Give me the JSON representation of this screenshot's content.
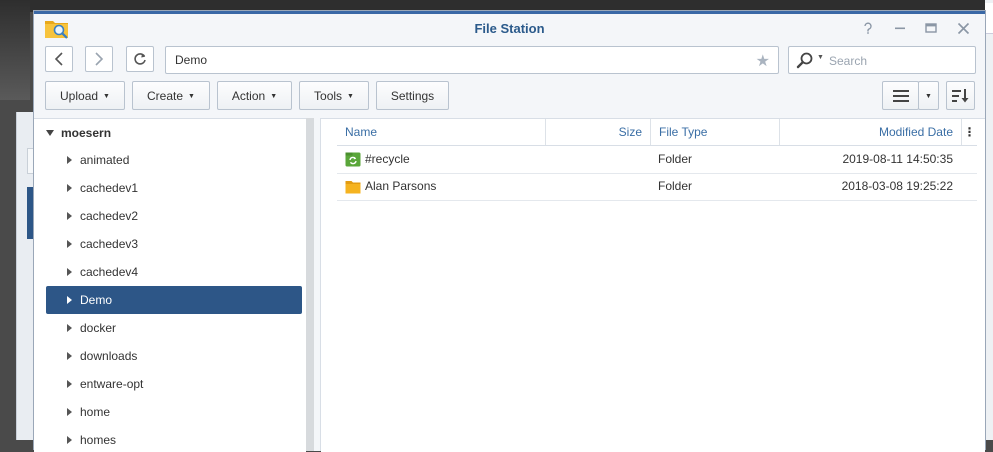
{
  "window": {
    "title": "File Station"
  },
  "nav": {
    "path": "Demo",
    "search_placeholder": "Search"
  },
  "toolbar": {
    "upload": "Upload",
    "create": "Create",
    "action": "Action",
    "tools": "Tools",
    "settings": "Settings"
  },
  "tree": {
    "root": "moesern",
    "items": [
      {
        "label": "animated"
      },
      {
        "label": "cachedev1"
      },
      {
        "label": "cachedev2"
      },
      {
        "label": "cachedev3"
      },
      {
        "label": "cachedev4"
      },
      {
        "label": "Demo",
        "selected": true
      },
      {
        "label": "docker"
      },
      {
        "label": "downloads"
      },
      {
        "label": "entware-opt"
      },
      {
        "label": "home"
      },
      {
        "label": "homes"
      }
    ]
  },
  "filelist": {
    "columns": {
      "name": "Name",
      "size": "Size",
      "type": "File Type",
      "modified": "Modified Date"
    },
    "rows": [
      {
        "name": "#recycle",
        "size": "",
        "type": "Folder",
        "modified": "2019-08-11 14:50:35",
        "icon": "recycle-folder-icon"
      },
      {
        "name": "Alan Parsons",
        "size": "",
        "type": "Folder",
        "modified": "2018-03-08 19:25:22",
        "icon": "folder-icon"
      }
    ]
  },
  "colors": {
    "accent": "#2d5687",
    "title": "#2b5a8b",
    "header_text": "#3a6ea5",
    "folder": "#f5b320",
    "recycle": "#5aa63a"
  }
}
